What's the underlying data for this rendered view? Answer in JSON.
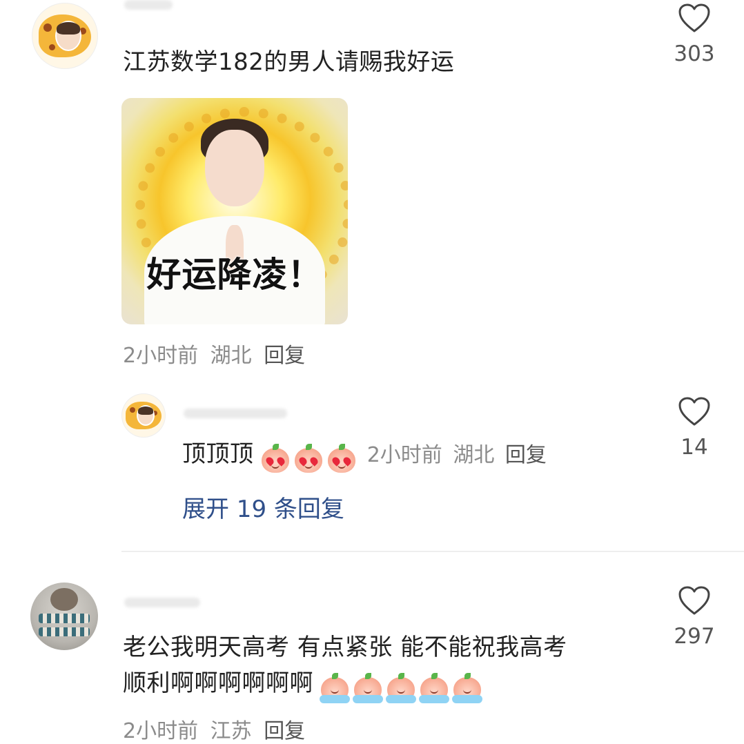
{
  "comments": [
    {
      "text": "江苏数学182的男人请赐我好运",
      "sticker_caption": "好运降凌！",
      "time": "2小时前",
      "location": "湖北",
      "reply_label": "回复",
      "likes": "303",
      "avatar_icon": "cheese-avatar-icon",
      "replies": [
        {
          "text": "顶顶顶",
          "emojis": [
            "heart-eyes-peach-icon",
            "heart-eyes-peach-icon",
            "heart-eyes-peach-icon"
          ],
          "time": "2小时前",
          "location": "湖北",
          "reply_label": "回复",
          "likes": "14"
        }
      ],
      "expand_label": "展开 19 条回复"
    },
    {
      "text_line1": "老公我明天高考 有点紧张 能不能祝我高考",
      "text_line2": "顺利啊啊啊啊啊啊",
      "emojis": [
        "crying-peach-icon",
        "crying-peach-icon",
        "crying-peach-icon",
        "crying-peach-icon",
        "crying-peach-icon"
      ],
      "time": "2小时前",
      "location": "江苏",
      "reply_label": "回复",
      "likes": "297",
      "avatar_icon": "hamster-jar-avatar-icon"
    }
  ],
  "colors": {
    "link": "#2f4f8a",
    "meta": "#8b8b8b",
    "text": "#222222"
  }
}
